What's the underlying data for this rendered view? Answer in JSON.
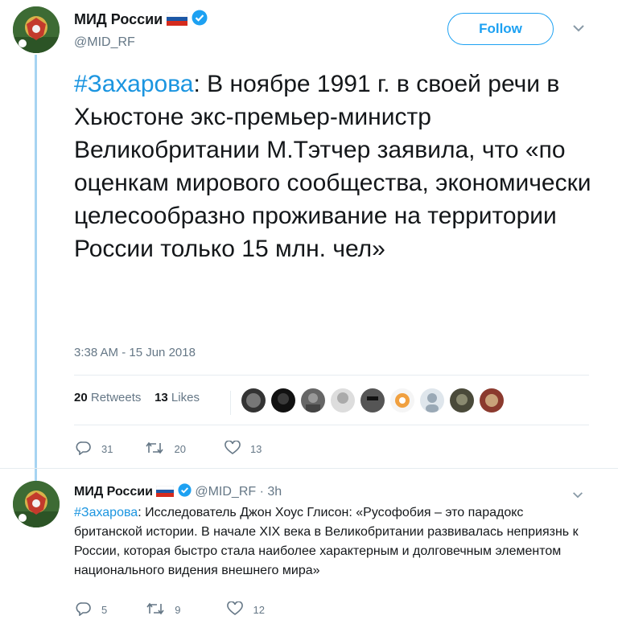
{
  "main_tweet": {
    "author_name": "МИД России",
    "author_handle": "@MID_RF",
    "follow_label": "Follow",
    "hashtag": "#Захарова",
    "text": ": В ноябре 1991 г. в своей речи в Хьюстоне экс-премьер-министр Великобритании М.Тэтчер заявила, что «по оценкам мирового сообщества, экономически целесообразно проживание на территории России только 15 млн. чел»",
    "timestamp": "3:38 AM - 15 Jun 2018",
    "retweets_count": "20",
    "retweets_label": "Retweets",
    "likes_count": "13",
    "likes_label": "Likes",
    "reply_count": "31",
    "retweet_count": "20",
    "like_count": "13"
  },
  "reply_tweet": {
    "author_name": "МИД России",
    "author_handle": "@MID_RF",
    "time_ago": "· 3h",
    "hashtag": "#Захарова",
    "text": ": Исследователь Джон Хоус Глисон: «Русофобия – это парадокс британской истории. В начале XIX века в Великобритании развивалась неприязнь к России, которая быстро стала наиболее характерным и долговечным элементом национального видения внешнего мира»",
    "reply_count": "5",
    "retweet_count": "9",
    "like_count": "12"
  },
  "colors": {
    "accent": "#1da1f2",
    "hashtag": "#1b95e0",
    "muted": "#657786",
    "thread_line": "#a6d4f2"
  },
  "icons": [
    "verified-badge-icon",
    "russian-flag-icon",
    "chevron-down-icon",
    "reply-icon",
    "retweet-icon",
    "like-icon"
  ]
}
